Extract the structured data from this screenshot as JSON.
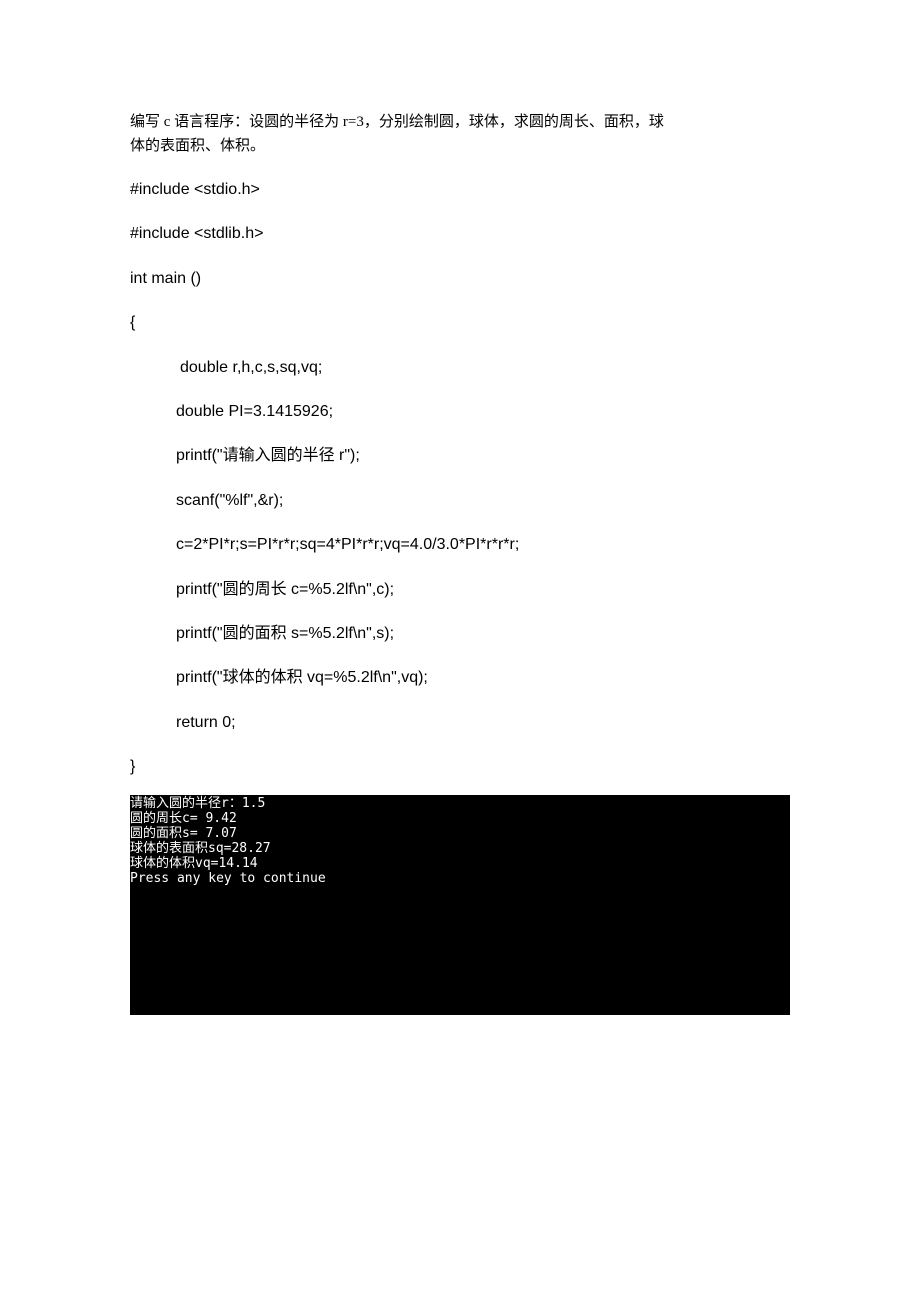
{
  "problem": {
    "line1": "编写 c 语言程序：设圆的半径为 r=3，分别绘制圆，球体，求圆的周长、面积，球",
    "line2": "体的表面积、体积。"
  },
  "code": {
    "l1": "#include <stdio.h>",
    "l2": "#include <stdlib.h>",
    "l3": "int main ()",
    "l4": "{",
    "l5": " double r,h,c,s,sq,vq;",
    "l6": "double PI=3.1415926;",
    "l7": "printf(\"请输入圆的半径 r\");",
    "l8": "scanf(\"%lf\",&r);",
    "l9": "c=2*PI*r;s=PI*r*r;sq=4*PI*r*r;vq=4.0/3.0*PI*r*r*r;",
    "l10": "printf(\"圆的周长 c=%5.2lf\\n\",c);",
    "l11": "printf(\"圆的面积 s=%5.2lf\\n\",s);",
    "l12": "printf(\"球体的体积 vq=%5.2lf\\n\",vq);",
    "l13": "return 0;",
    "l14": "}"
  },
  "terminal": {
    "t1": "请输入圆的半径r：1.5",
    "t2": "圆的周长c= 9.42",
    "t3": "圆的面积s= 7.07",
    "t4": "球体的表面积sq=28.27",
    "t5": "球体的体积vq=14.14",
    "t6": "Press any key to continue"
  }
}
